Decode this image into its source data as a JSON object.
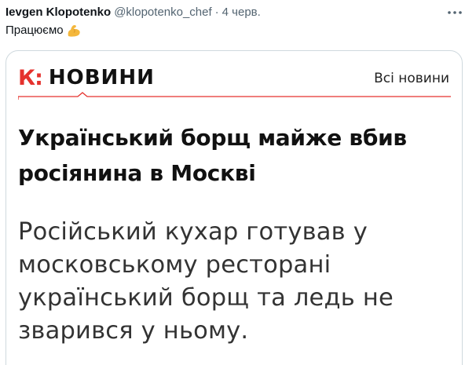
{
  "tweet": {
    "author_name": "Ievgen Klopotenko",
    "author_handle": "@klopotenko_chef",
    "separator": "·",
    "time": "4 черв.",
    "text": "Працюємо",
    "emoji": "flexed-biceps"
  },
  "card": {
    "logo_mark": "К:",
    "logo_text": "НОВИНИ",
    "all_news_link": "Всі новини",
    "headline_line1": "Український борщ майже вбив",
    "headline_line2": "росіянина в Москві",
    "lede_line1": "Російський кухар готував у",
    "lede_line2": "московському ресторані",
    "lede_line3": "український борщ та ледь не",
    "lede_line4": "зварився у ньому.",
    "accent_color": "#e5322d"
  }
}
